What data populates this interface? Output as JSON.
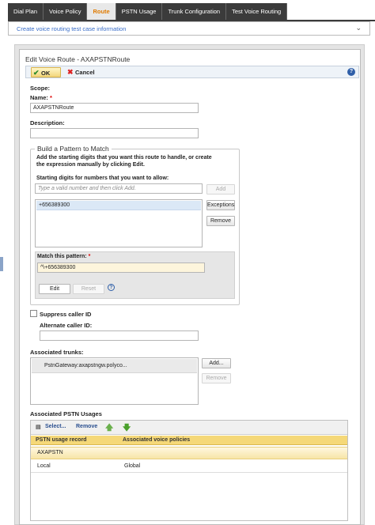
{
  "tabs": [
    {
      "label": "Dial Plan"
    },
    {
      "label": "Voice Policy"
    },
    {
      "label": "Route",
      "active": true
    },
    {
      "label": "PSTN Usage"
    },
    {
      "label": "Trunk Configuration"
    },
    {
      "label": "Test Voice Routing"
    }
  ],
  "testcase": {
    "label": "Create voice routing test case information",
    "chevron": "⌄"
  },
  "dialog": {
    "title": "Edit Voice Route - AXAPSTNRoute",
    "toolbar": {
      "ok": "OK",
      "cancel": "Cancel",
      "help": "?",
      "ok_icon": "✔",
      "cancel_icon": "✖"
    },
    "scope_label": "Scope:",
    "name_label": "Name:",
    "required_mark": "*",
    "name_value": "AXAPSTNRoute",
    "description_label": "Description:",
    "description_value": ""
  },
  "pattern": {
    "legend": "Build a Pattern to Match",
    "instructions": "Add the starting digits that you want this route to handle, or create the expression manually by clicking Edit.",
    "starting_label": "Starting digits for numbers that you want to allow:",
    "starting_placeholder": "Type a valid number and then click Add.",
    "add": "Add",
    "numbers": [
      "+656389300"
    ],
    "exceptions": "Exceptions",
    "remove": "Remove",
    "match_label": "Match this pattern:",
    "match_value": "^\\+656389300",
    "edit": "Edit",
    "reset": "Reset",
    "help": "?"
  },
  "caller": {
    "suppress_label": "Suppress caller ID",
    "suppress_checked": false,
    "alternate_label": "Alternate caller ID:",
    "alternate_value": ""
  },
  "trunks": {
    "label": "Associated trunks:",
    "items": [
      "PstnGateway:axapstngw.polyco..."
    ],
    "add": "Add...",
    "remove": "Remove"
  },
  "pstn": {
    "label": "Associated PSTN Usages",
    "select": "Select...",
    "remove": "Remove",
    "up_icon": "🡅",
    "down_icon": "🡇",
    "columns": [
      "PSTN usage record",
      "Associated voice policies"
    ],
    "rows": [
      {
        "record": "AXAPSTN",
        "policies": ""
      },
      {
        "record": "Local",
        "policies": "Global"
      }
    ]
  },
  "colors": {
    "accent": "#e07b00",
    "link": "#3a6ec8",
    "header_yellow": "#f5d878"
  }
}
